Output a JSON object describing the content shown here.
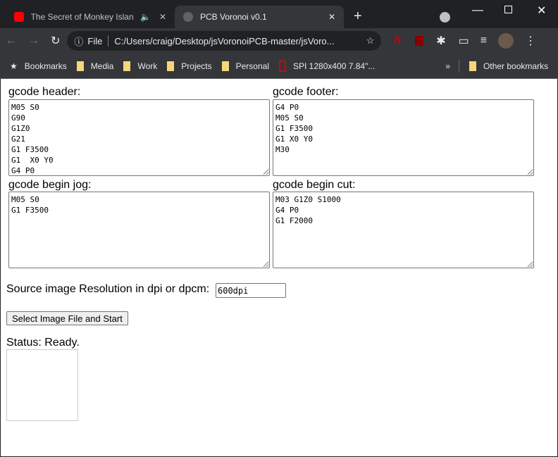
{
  "browser": {
    "tabs": [
      {
        "title": "The Secret of Monkey Island",
        "active": false
      },
      {
        "title": "PCB Voronoi v0.1",
        "active": true
      }
    ],
    "address": {
      "scheme_label": "File",
      "url": "C:/Users/craig/Desktop/jsVoronoiPCB-master/jsVoro..."
    },
    "bookmarks": [
      "Bookmarks",
      "Media",
      "Work",
      "Projects",
      "Personal",
      "SPI 1280x400 7.84\"...",
      "Other bookmarks"
    ]
  },
  "form": {
    "header_label": "gcode header:",
    "header_value": "M05 S0\nG90\nG1Z0\nG21\nG1 F3500\nG1  X0 Y0\nG4 P0",
    "footer_label": "gcode footer:",
    "footer_value": "G4 P0\nM05 S0\nG1 F3500\nG1 X0 Y0\nM30",
    "jog_label": "gcode begin jog:",
    "jog_value": "M05 S0\nG1 F3500",
    "cut_label": "gcode begin cut:",
    "cut_value": "M03 G1Z0 S1000\nG4 P0\nG1 F2000",
    "resolution_label": "Source image Resolution in dpi or dpcm:",
    "resolution_value": "600dpi",
    "select_button": "Select Image File and Start",
    "status": "Status: Ready."
  }
}
